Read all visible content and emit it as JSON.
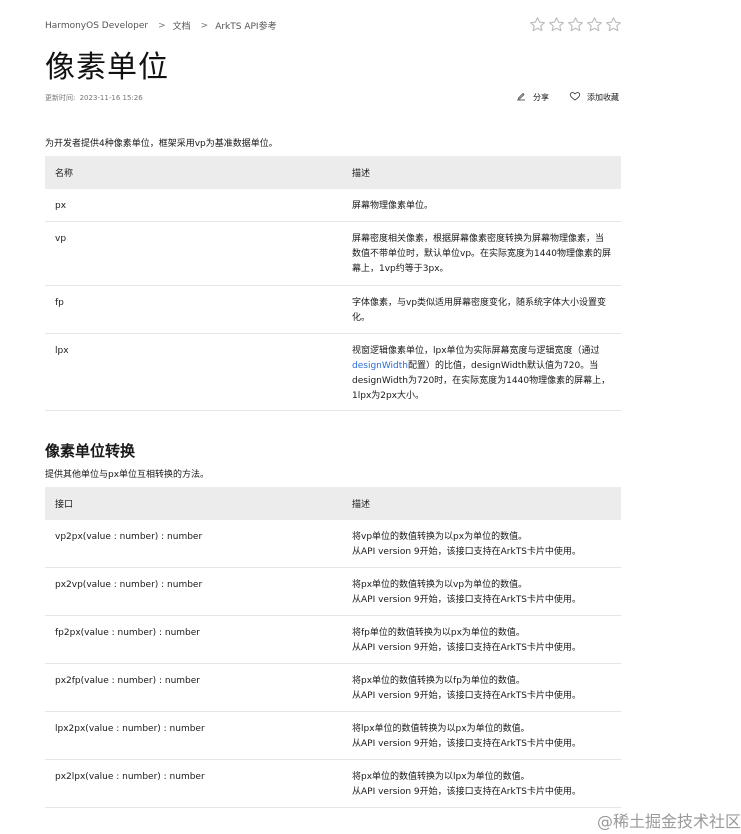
{
  "breadcrumb": {
    "home": "HarmonyOS Developer",
    "sep": ">",
    "docs": "文档",
    "api_ref": "ArkTS API参考"
  },
  "rating": {
    "stars": 5,
    "filled": 0
  },
  "page": {
    "title": "像素单位",
    "updated_label": "更新时间:",
    "updated_value": "2023-11-16 15:26"
  },
  "actions": {
    "share": "分享",
    "favorite": "添加收藏"
  },
  "intro": "为开发者提供4种像素单位，框架采用vp为基准数据单位。",
  "units_table": {
    "headers": [
      "名称",
      "描述"
    ],
    "rows": [
      {
        "name": "px",
        "desc": "屏幕物理像素单位。"
      },
      {
        "name": "vp",
        "desc": "屏幕密度相关像素，根据屏幕像素密度转换为屏幕物理像素，当数值不带单位时，默认单位vp。在实际宽度为1440物理像素的屏幕上，1vp约等于3px。"
      },
      {
        "name": "fp",
        "desc": "字体像素，与vp类似适用屏幕密度变化，随系统字体大小设置变化。"
      },
      {
        "name": "lpx",
        "desc_pre": "视窗逻辑像素单位，lpx单位为实际屏幕宽度与逻辑宽度（通过",
        "desc_link": "designWidth",
        "desc_post": "配置）的比值，designWidth默认值为720。当designWidth为720时，在实际宽度为1440物理像素的屏幕上，1lpx为2px大小。"
      }
    ]
  },
  "conversion": {
    "title": "像素单位转换",
    "desc": "提供其他单位与px单位互相转换的方法。",
    "headers": [
      "接口",
      "描述"
    ],
    "rows": [
      {
        "api": "vp2px(value : number) : number",
        "desc": "将vp单位的数值转换为以px为单位的数值。",
        "note": "从API version 9开始，该接口支持在ArkTS卡片中使用。"
      },
      {
        "api": "px2vp(value : number) : number",
        "desc": "将px单位的数值转换为以vp为单位的数值。",
        "note": "从API version 9开始，该接口支持在ArkTS卡片中使用。"
      },
      {
        "api": "fp2px(value : number) : number",
        "desc": "将fp单位的数值转换为以px为单位的数值。",
        "note": "从API version 9开始，该接口支持在ArkTS卡片中使用。"
      },
      {
        "api": "px2fp(value : number) : number",
        "desc": "将px单位的数值转换为以fp为单位的数值。",
        "note": "从API version 9开始，该接口支持在ArkTS卡片中使用。"
      },
      {
        "api": "lpx2px(value : number) : number",
        "desc": "将lpx单位的数值转换为以px为单位的数值。",
        "note": "从API version 9开始，该接口支持在ArkTS卡片中使用。"
      },
      {
        "api": "px2lpx(value : number) : number",
        "desc": "将px单位的数值转换为以lpx为单位的数值。",
        "note": "从API version 9开始，该接口支持在ArkTS卡片中使用。"
      }
    ]
  },
  "watermark": "@稀土掘金技术社区"
}
